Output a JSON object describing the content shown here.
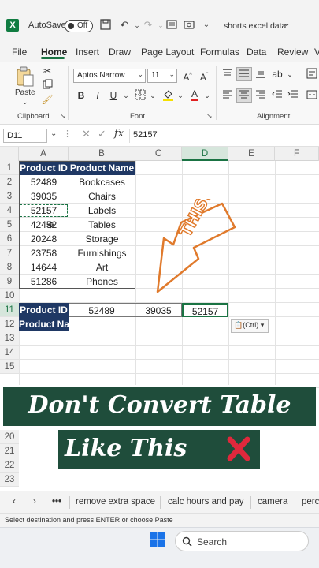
{
  "titlebar": {
    "app_icon": "X",
    "autosave_label": "AutoSave",
    "autosave_state": "Off",
    "doc_title": "shorts excel data",
    "doc_title_chevron": "⌄"
  },
  "ribbon_tabs": [
    "File",
    "Home",
    "Insert",
    "Draw",
    "Page Layout",
    "Formulas",
    "Data",
    "Review",
    "V"
  ],
  "ribbon": {
    "paste_label": "Paste",
    "clipboard_label": "Clipboard",
    "font_name": "Aptos Narrow",
    "font_size": "11",
    "font_label": "Font",
    "alignment_label": "Alignment",
    "bold": "B",
    "italic": "I",
    "underline": "U",
    "grow_font": "A^",
    "shrink_font": "Aˇ",
    "font_color": "A"
  },
  "formula_bar": {
    "name_box": "D11",
    "fx": "fx",
    "value": "52157"
  },
  "grid": {
    "columns": [
      "A",
      "B",
      "C",
      "D",
      "E",
      "F"
    ],
    "rows": [
      "1",
      "2",
      "3",
      "4",
      "5",
      "6",
      "7",
      "8",
      "9",
      "10",
      "11",
      "12",
      "13",
      "14",
      "15"
    ],
    "header": [
      "Product ID",
      "Product Name"
    ],
    "records": [
      [
        "52489",
        "Bookcases"
      ],
      [
        "39035",
        "Chairs"
      ],
      [
        "52157",
        "Labels"
      ],
      [
        "42452",
        "Tables"
      ],
      [
        "20248",
        "Storage"
      ],
      [
        "23758",
        "Furnishings"
      ],
      [
        "14644",
        "Art"
      ],
      [
        "51286",
        "Phones"
      ]
    ],
    "row11_label": "Product ID",
    "row11_values": [
      "52489",
      "39035",
      "52157"
    ],
    "row12_label": "Product Name",
    "paste_options": "(Ctrl)",
    "annotation": "THIS!"
  },
  "banner": {
    "line1": "Don't Convert Table",
    "line2": "Like This"
  },
  "sheet_tabs": [
    "remove extra space",
    "calc hours and pay",
    "camera",
    "perc"
  ],
  "status_text": "Select destination and press ENTER or choose Paste",
  "taskbar": {
    "search_label": "Search"
  },
  "colors": {
    "accent": "#1a7343",
    "table_header": "#1f3864",
    "banner_bg": "#1f4d3b",
    "annotation": "#e07a2c",
    "x_mark": "#e0283c"
  }
}
